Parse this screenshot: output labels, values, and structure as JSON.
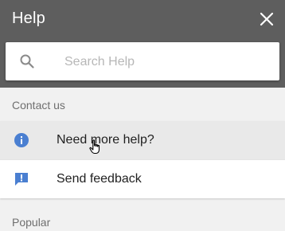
{
  "header": {
    "title": "Help",
    "close_icon": "close-icon"
  },
  "search": {
    "placeholder": "Search Help",
    "value": "",
    "icon": "search-icon"
  },
  "contact": {
    "heading": "Contact us",
    "items": [
      {
        "label": "Need more help?",
        "icon": "info-icon",
        "icon_color": "#4a7fd1",
        "hovered": true
      },
      {
        "label": "Send feedback",
        "icon": "feedback-icon",
        "icon_color": "#4a7fd1",
        "hovered": false
      }
    ]
  },
  "popular": {
    "heading": "Popular"
  },
  "colors": {
    "header_bg": "#5e5e5e",
    "page_bg": "#f1f1f1",
    "accent": "#4a7fd1"
  }
}
